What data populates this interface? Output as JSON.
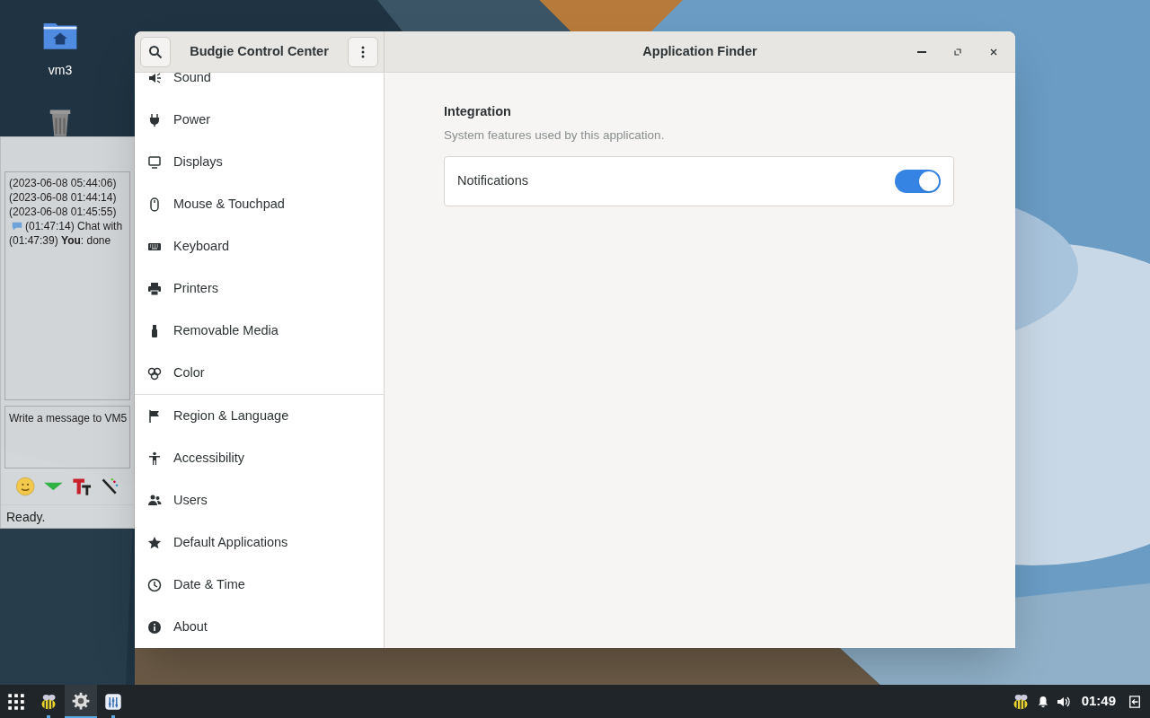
{
  "desktop": {
    "icons": [
      {
        "label": "vm3"
      }
    ]
  },
  "chat_window": {
    "messages": [
      "(2023-06-08 05:44:06)",
      "(2023-06-08 01:44:14)",
      "(2023-06-08 01:45:55)",
      "(01:47:14) Chat with",
      "(01:47:39) **You**: done"
    ],
    "message_placeholder": "Write a message to VM5",
    "status": "Ready."
  },
  "window": {
    "title": "Budgie Control Center",
    "page_title": "Application Finder"
  },
  "sidebar": {
    "items": [
      {
        "label": "Sound"
      },
      {
        "label": "Power"
      },
      {
        "label": "Displays"
      },
      {
        "label": "Mouse & Touchpad"
      },
      {
        "label": "Keyboard"
      },
      {
        "label": "Printers"
      },
      {
        "label": "Removable Media"
      },
      {
        "label": "Color"
      },
      {
        "label": "Region & Language"
      },
      {
        "label": "Accessibility"
      },
      {
        "label": "Users"
      },
      {
        "label": "Default Applications"
      },
      {
        "label": "Date & Time"
      },
      {
        "label": "About"
      }
    ]
  },
  "content": {
    "section_title": "Integration",
    "section_subtitle": "System features used by this application.",
    "settings": [
      {
        "label": "Notifications",
        "on": true
      }
    ]
  },
  "taskbar": {
    "apps": [
      {
        "selected": false
      },
      {
        "selected": true
      },
      {
        "selected": false
      }
    ],
    "clock": "01:49"
  }
}
